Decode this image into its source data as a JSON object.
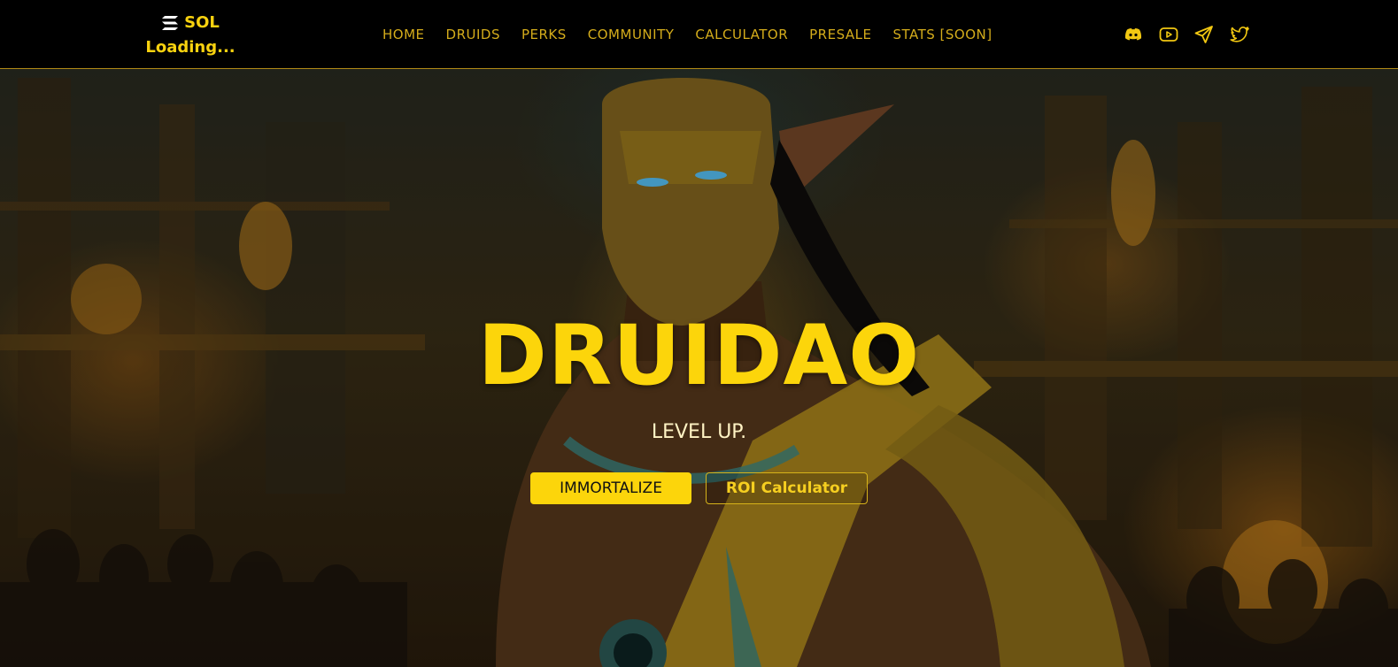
{
  "header": {
    "sol_label": "SOL",
    "sol_price": "Loading...",
    "nav": [
      "HOME",
      "DRUIDS",
      "PERKS",
      "COMMUNITY",
      "CALCULATOR",
      "PRESALE",
      "STATS [SOON]"
    ],
    "socials": [
      "discord-icon",
      "youtube-icon",
      "telegram-icon",
      "twitter-icon"
    ]
  },
  "hero": {
    "title": "DRUIDAO",
    "subtitle": "LEVEL UP.",
    "primary_button": "IMMORTALIZE",
    "secondary_button": "ROI Calculator"
  },
  "colors": {
    "accent": "#fcd50b",
    "nav_text": "#d4ac1b",
    "background": "#000000"
  }
}
